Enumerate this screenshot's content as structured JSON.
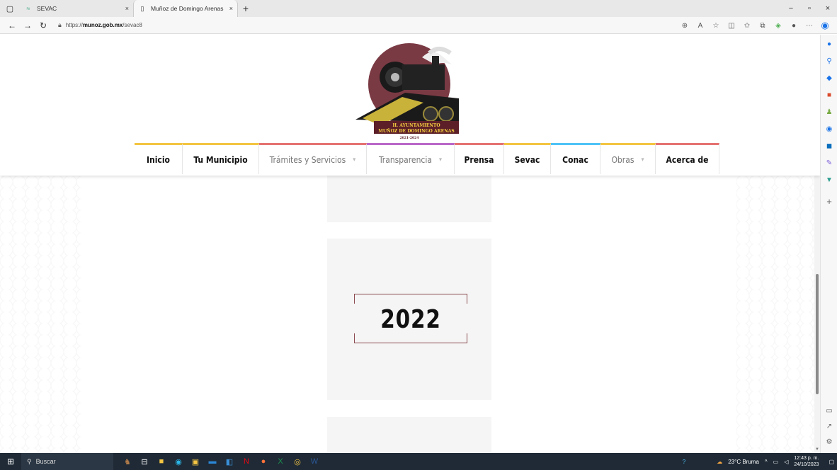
{
  "browser": {
    "tabs": [
      {
        "title": "SEVAC",
        "close": "×"
      },
      {
        "title": "Muñoz de Domingo Arenas",
        "close": "×"
      }
    ],
    "new_tab": "+",
    "window_controls": {
      "minimize": "−",
      "maximize": "▫",
      "close": "×"
    },
    "url_prefix": "https://",
    "url_domain": "munoz.gob.mx",
    "url_path": "/sevac8",
    "nav": {
      "back": "←",
      "forward": "→",
      "refresh": "↻"
    }
  },
  "site": {
    "logo_lines": [
      "H. AYUNTAMIENTO",
      "MUÑOZ DE DOMINGO ARENAS",
      "2021-2024"
    ],
    "nav": [
      {
        "label": "Inicio",
        "dropdown": false
      },
      {
        "label": "Tu Municipio",
        "dropdown": false
      },
      {
        "label": "Trámites y Servicios",
        "dropdown": true
      },
      {
        "label": "Transparencia",
        "dropdown": true
      },
      {
        "label": "Prensa",
        "dropdown": false
      },
      {
        "label": "Sevac",
        "dropdown": false
      },
      {
        "label": "Conac",
        "dropdown": false
      },
      {
        "label": "Obras",
        "dropdown": true
      },
      {
        "label": "Acerca de",
        "dropdown": false
      }
    ],
    "nav_colors": [
      "#f4c542",
      "#f4c542",
      "#e57373",
      "#ba68c8",
      "#e57373",
      "#f4c542",
      "#4fc3f7",
      "#f4c542",
      "#e57373"
    ],
    "year_card": "2022",
    "accent": "#8b4a4f"
  },
  "taskbar": {
    "search_placeholder": "Buscar",
    "weather": "23°C  Bruma",
    "time": "12:43 p. m.",
    "date": "24/10/2023"
  }
}
